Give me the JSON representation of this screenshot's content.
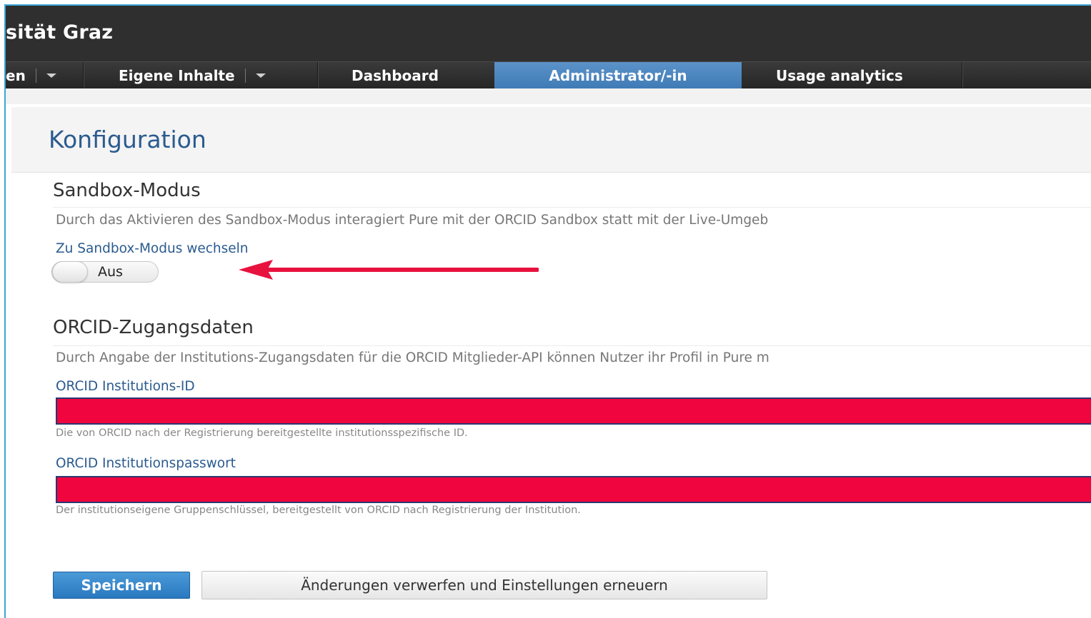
{
  "app": {
    "brand": "sität Graz"
  },
  "nav": {
    "items": [
      {
        "label": "en"
      },
      {
        "label": "Eigene Inhalte"
      },
      {
        "label": "Dashboard"
      },
      {
        "label": "Administrator/-in"
      },
      {
        "label": "Usage analytics"
      }
    ],
    "active_color": "#4a86c0"
  },
  "page": {
    "title": "Konfiguration"
  },
  "sandbox": {
    "title": "Sandbox-Modus",
    "description": "Durch das Aktivieren des Sandbox-Modus interagiert Pure mit der ORCID Sandbox statt mit der Live-Umgeb",
    "switch_label": "Zu Sandbox-Modus wechseln",
    "toggle_state": "Aus"
  },
  "credentials": {
    "title": "ORCID-Zugangsdaten",
    "description": "Durch Angabe der Institutions-Zugangsdaten für die ORCID Mitglieder-API können Nutzer ihr Profil in Pure m",
    "id_label": "ORCID Institutions-ID",
    "id_hint": "Die von ORCID nach der Registrierung bereitgestellte institutionsspezifische ID.",
    "password_label": "ORCID Institutionspasswort",
    "password_hint": "Der institutionseigene Gruppenschlüssel, bereitgestellt von ORCID nach Registrierung der Institution.",
    "redaction_color": "#f0053e"
  },
  "buttons": {
    "save": "Speichern",
    "discard": "Änderungen verwerfen und Einstellungen erneuern"
  },
  "annotation": {
    "arrow_color": "#e8123f",
    "arrow_icon": "arrow-left-icon"
  }
}
